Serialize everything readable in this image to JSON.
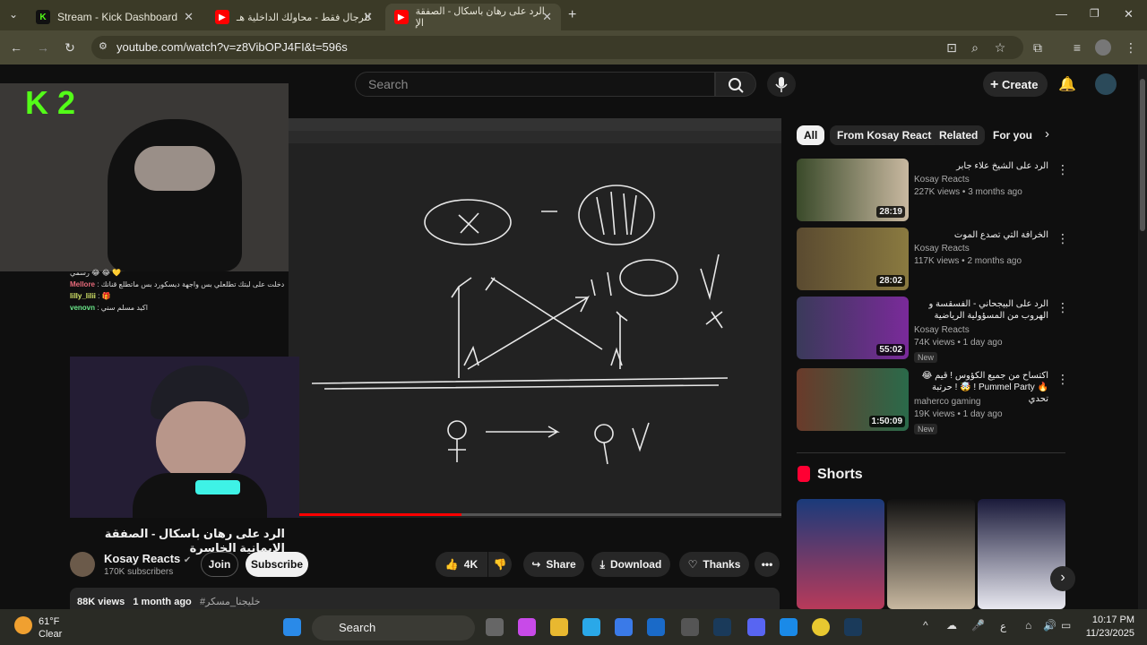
{
  "tabs": [
    {
      "title": "Stream - Kick Dashboard"
    },
    {
      "title": "للرجال فقط - محاولك الداخلية هـ"
    },
    {
      "title": "الرد على رهان باسكال - الصفقة الإ"
    }
  ],
  "url": "youtube.com/watch?v=z8VibOPJ4FI&t=596s",
  "search_placeholder": "Search",
  "create_label": "Create",
  "chips": [
    "All",
    "From Kosay Reacts",
    "Related",
    "For you"
  ],
  "overlay_logo": "K 2",
  "chat": [
    {
      "user": "",
      "msg": "رسمي 😂 😂 💛"
    },
    {
      "user": "Mellore",
      "msg": "دخلت على لبتك تطلعلي بس واجهة ديسكورد بس ماتطلع قنانك"
    },
    {
      "user": "lilly_lilii",
      "msg": "🎁"
    },
    {
      "user": "venovn",
      "msg": "اكيد مسلم سني"
    }
  ],
  "video_title": "الرد على رهان باسكال - الصفقة الإيمانية الخاسرة",
  "channel_name": "Kosay Reacts",
  "subscribers": "170K subscribers",
  "join_label": "Join",
  "subscribe_label": "Subscribe",
  "like_count": "4K",
  "share_label": "Share",
  "download_label": "Download",
  "thanks_label": "Thanks",
  "views": "88K views",
  "posted": "1 month ago",
  "hashtag": "#خليجنا_مسكر",
  "side_videos": [
    {
      "title": "الرد على الشيخ علاء جابر",
      "channel": "Kosay Reacts",
      "meta": "227K views • 3 months ago",
      "duration": "28:19",
      "badge": ""
    },
    {
      "title": "الخرافة التي تصدع الموت",
      "channel": "Kosay Reacts",
      "meta": "117K views • 2 months ago",
      "duration": "28:02",
      "badge": ""
    },
    {
      "title": "الرد على البيجحاني - الفسقسة و الهروب من المسؤولية الرياضية",
      "channel": "Kosay Reacts",
      "meta": "74K views • 1 day ago",
      "duration": "55:02",
      "badge": "New"
    },
    {
      "title": "😂 اكتساح من جميع الكؤوس ! قيم حرتبة ! 🤯 ! Pummel Party 🔥 تحدي",
      "channel": "maherco gaming",
      "meta": "19K views • 1 day ago",
      "duration": "1:50:09",
      "badge": "New"
    }
  ],
  "shorts_label": "Shorts",
  "weather": {
    "temp": "61°F",
    "cond": "Clear"
  },
  "taskbar_search": "Search",
  "clock": {
    "time": "10:17 PM",
    "date": "11/23/2025"
  },
  "lang": "ع",
  "colors": {
    "yt_red": "#ff0000",
    "kick_green": "#53fc18"
  }
}
